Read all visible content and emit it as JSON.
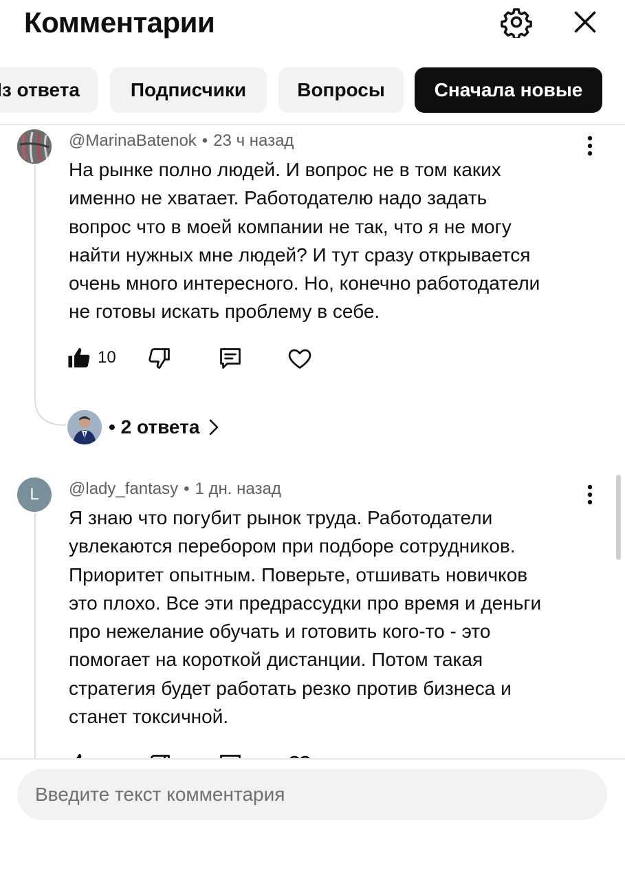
{
  "header": {
    "title": "Комментарии",
    "settings_icon": "gear-icon",
    "close_icon": "close-icon"
  },
  "filters": [
    {
      "label": "Из ответа",
      "active": false
    },
    {
      "label": "Подписчики",
      "active": false
    },
    {
      "label": "Вопросы",
      "active": false
    },
    {
      "label": "Сначала новые",
      "active": true
    }
  ],
  "comments": [
    {
      "author": "@MarinaBatenok",
      "time": "23 ч назад",
      "text": "На рынке полно людей. И вопрос не в том каких\nименно не хватает. Работодателю надо задать\nвопрос что в моей компании не так, что я не могу\nнайти нужных мне людей? И тут сразу открывается\nочень много интересного. Но, конечно работодатели\nне готовы искать проблему в себе.",
      "likes": "10",
      "replies": "2 ответа"
    },
    {
      "author": "@lady_fantasy",
      "time": "1 дн. назад",
      "avatar_letter": "L",
      "avatar_color": "#78909c",
      "text": "Я знаю что погубит рынок труда. Работодатели\nувлекаются перебором при подборе сотрудников.\nПриоритет опытным. Поверьте, отшивать новичков\nэто плохо. Все эти предрассудки про время и деньги\nпро нежелание обучать и готовить кого-то - это\nпомогает на короткой дистанции. Потом такая\nстратегия будет работать резко против бизнеса и\nстанет токсичной."
    }
  ],
  "composer": {
    "placeholder": "Введите текст комментария"
  }
}
